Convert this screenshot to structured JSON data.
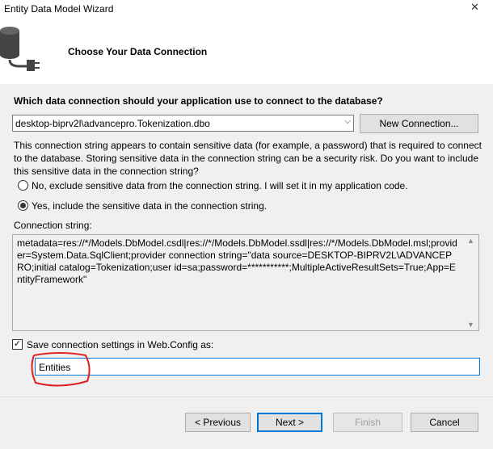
{
  "window": {
    "title": "Entity Data Model Wizard",
    "close_glyph": "✕"
  },
  "header": {
    "icon": "database-plug-icon",
    "heading": "Choose Your Data Connection"
  },
  "question": "Which data connection should your application use to connect to the database?",
  "connection": {
    "selected": "desktop-biprv2l\\advancepro.Tokenization.dbo",
    "dropdown_glyph": "⌵",
    "new_connection_label": "New Connection..."
  },
  "sensitive": {
    "description": "This connection string appears to contain sensitive data (for example, a password) that is required to connect to the database. Storing sensitive data in the connection string can be a security risk. Do you want to include this sensitive data in the connection string?",
    "option_no": "No, exclude sensitive data from the connection string. I will set it in my application code.",
    "option_yes": "Yes, include the sensitive data in the connection string.",
    "selected": "yes"
  },
  "connection_string": {
    "label": "Connection string:",
    "value": "metadata=res://*/Models.DbModel.csdl|res://*/Models.DbModel.ssdl|res://*/Models.DbModel.msl;provider=System.Data.SqlClient;provider connection string=\"data source=DESKTOP-BIPRV2L\\ADVANCEPRO;initial catalog=Tokenization;user id=sa;password=***********;MultipleActiveResultSets=True;App=EntityFramework\""
  },
  "save_settings": {
    "checked": true,
    "label": "Save connection settings in Web.Config as:",
    "value": "Entities"
  },
  "buttons": {
    "previous": "< Previous",
    "next": "Next >",
    "finish": "Finish",
    "cancel": "Cancel"
  },
  "colors": {
    "accent": "#0078d7",
    "annotation": "#e02020"
  }
}
